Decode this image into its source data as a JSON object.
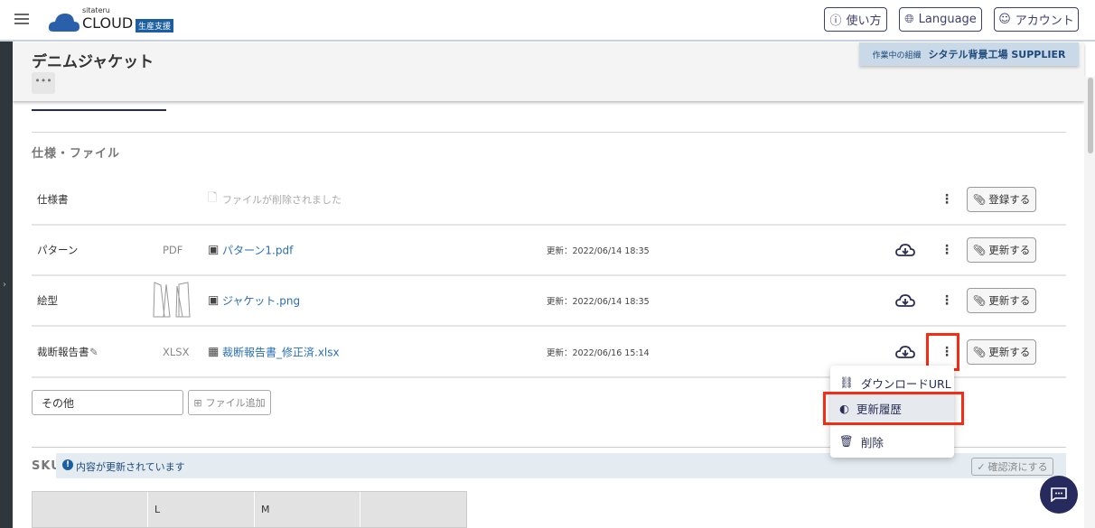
{
  "header": {
    "logo_small": "sitateru",
    "logo_main": "CLOUD",
    "logo_badge": "生産支援",
    "help": "使い方",
    "language": "Language",
    "account": "アカウント"
  },
  "page": {
    "title": "デニムジャケット",
    "more": "•••",
    "org_label": "作業中の組織",
    "org_name": "シタテル背景工場 SUPPLIER"
  },
  "files": {
    "section_title": "仕様・ファイル",
    "rows": [
      {
        "label": "仕様書",
        "type": "",
        "file": "ファイルが削除されました",
        "date": "",
        "action": "登録する"
      },
      {
        "label": "パターン",
        "type": "PDF",
        "file": "パターン1.pdf",
        "date": "更新：2022/06/14 18:35",
        "action": "更新する"
      },
      {
        "label": "絵型",
        "type": "",
        "file": "ジャケット.png",
        "date": "更新：2022/06/14 18:35",
        "action": "更新する"
      },
      {
        "label": "裁断報告書",
        "type": "XLSX",
        "file": "裁断報告書_修正済.xlsx",
        "date": "更新：2022/06/16 15:14",
        "action": "更新する"
      }
    ],
    "other_value": "その他",
    "add_file": "ファイル追加"
  },
  "menu": {
    "items": [
      {
        "label": "ダウンロードURL",
        "icon": "link-icon"
      },
      {
        "label": "更新履歴",
        "icon": "history-icon"
      },
      {
        "label": "削除",
        "icon": "trash-icon"
      }
    ]
  },
  "sku": {
    "title": "SKU",
    "notice": "内容が更新されています",
    "confirm": "確認済にする",
    "columns": [
      "",
      "L",
      "M",
      ""
    ]
  },
  "colors": {
    "accent": "#262a5c",
    "highlight": "#f52b13",
    "link": "#2a6fb3"
  }
}
